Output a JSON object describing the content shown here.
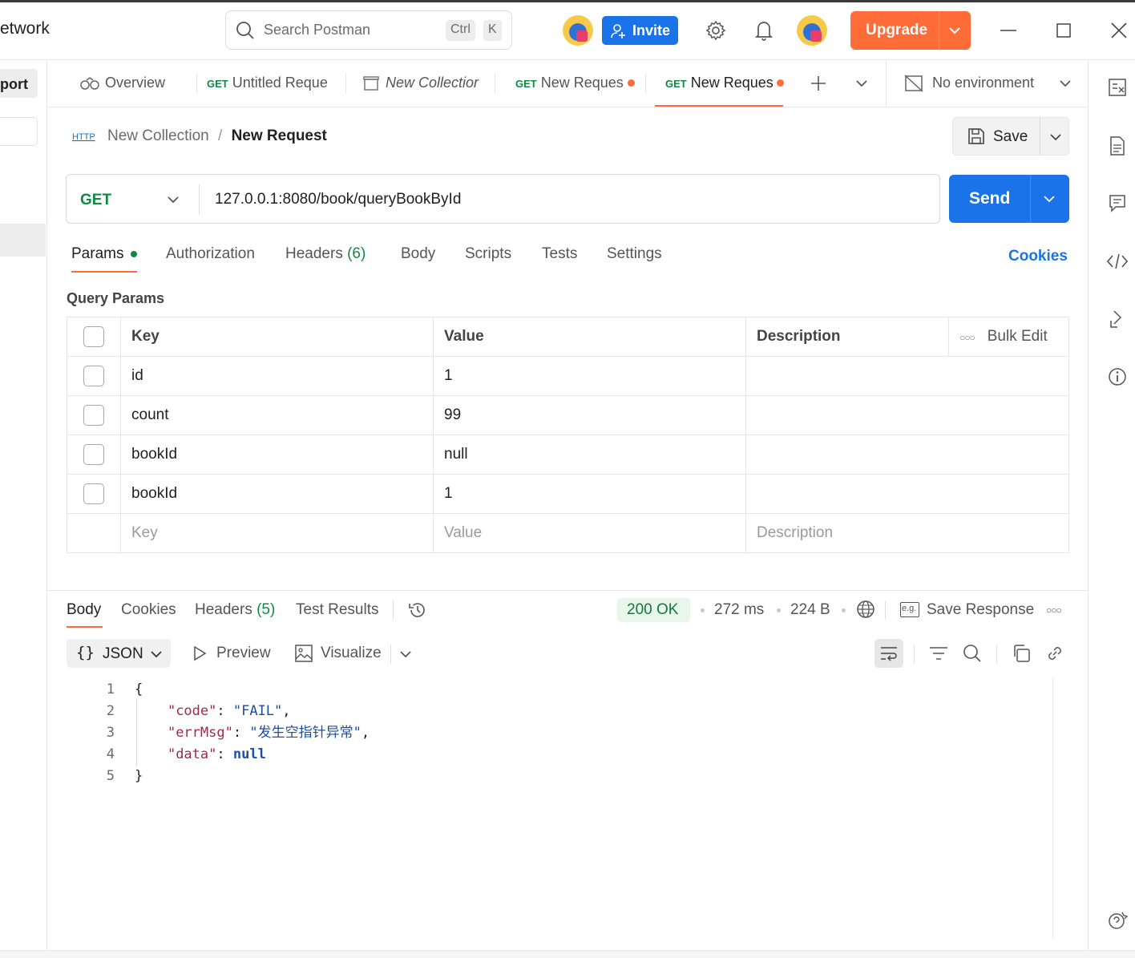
{
  "header": {
    "workspace_name": "etwork",
    "search_placeholder": "Search Postman",
    "shortcut_ctrl": "Ctrl",
    "shortcut_key": "K",
    "invite_label": "Invite",
    "upgrade_label": "Upgrade"
  },
  "sidebar": {
    "import_label": "port"
  },
  "tabs": [
    {
      "label": "Overview",
      "method": ""
    },
    {
      "label": "Untitled Reque",
      "method": "GET"
    },
    {
      "label": "New Collectior",
      "method": ""
    },
    {
      "label": "New Reques",
      "method": "GET"
    },
    {
      "label": "New Reques",
      "method": "GET"
    }
  ],
  "environment": {
    "label": "No environment"
  },
  "breadcrumb": {
    "icon_text": "HTTP",
    "collection": "New Collection",
    "separator": "/",
    "request": "New Request"
  },
  "save_label": "Save",
  "request": {
    "method": "GET",
    "url": "127.0.0.1:8080/book/queryBookById",
    "send_label": "Send"
  },
  "request_tabs": {
    "params": "Params",
    "authorization": "Authorization",
    "headers": "Headers",
    "headers_count": "(6)",
    "body": "Body",
    "scripts": "Scripts",
    "tests": "Tests",
    "settings": "Settings",
    "cookies": "Cookies"
  },
  "query_params": {
    "title": "Query Params",
    "columns": {
      "key": "Key",
      "value": "Value",
      "description": "Description",
      "bulk_edit": "Bulk Edit"
    },
    "rows": [
      {
        "key": "id",
        "value": "1",
        "description": ""
      },
      {
        "key": "count",
        "value": "99",
        "description": ""
      },
      {
        "key": "bookId",
        "value": "null",
        "description": ""
      },
      {
        "key": "bookId",
        "value": "1",
        "description": ""
      }
    ],
    "placeholders": {
      "key": "Key",
      "value": "Value",
      "description": "Description"
    }
  },
  "response": {
    "tabs": {
      "body": "Body",
      "cookies": "Cookies",
      "headers": "Headers",
      "headers_count": "(5)",
      "test_results": "Test Results"
    },
    "status": "200 OK",
    "time": "272 ms",
    "size": "224 B",
    "save_response": "Save Response",
    "format": "JSON",
    "preview": "Preview",
    "visualize": "Visualize",
    "eg_badge": "e.g.",
    "line_numbers": [
      "1",
      "2",
      "3",
      "4",
      "5"
    ],
    "code_lines": {
      "open": "{",
      "code_key": "\"code\"",
      "code_val": "\"FAIL\"",
      "errmsg_key": "\"errMsg\"",
      "errmsg_val": "\"发生空指针异常\"",
      "data_key": "\"data\"",
      "data_val": "null",
      "close": "}"
    }
  },
  "colors": {
    "accent": "#FF6C37",
    "primary": "#1A73E8",
    "get_method": "#0F8A43"
  }
}
